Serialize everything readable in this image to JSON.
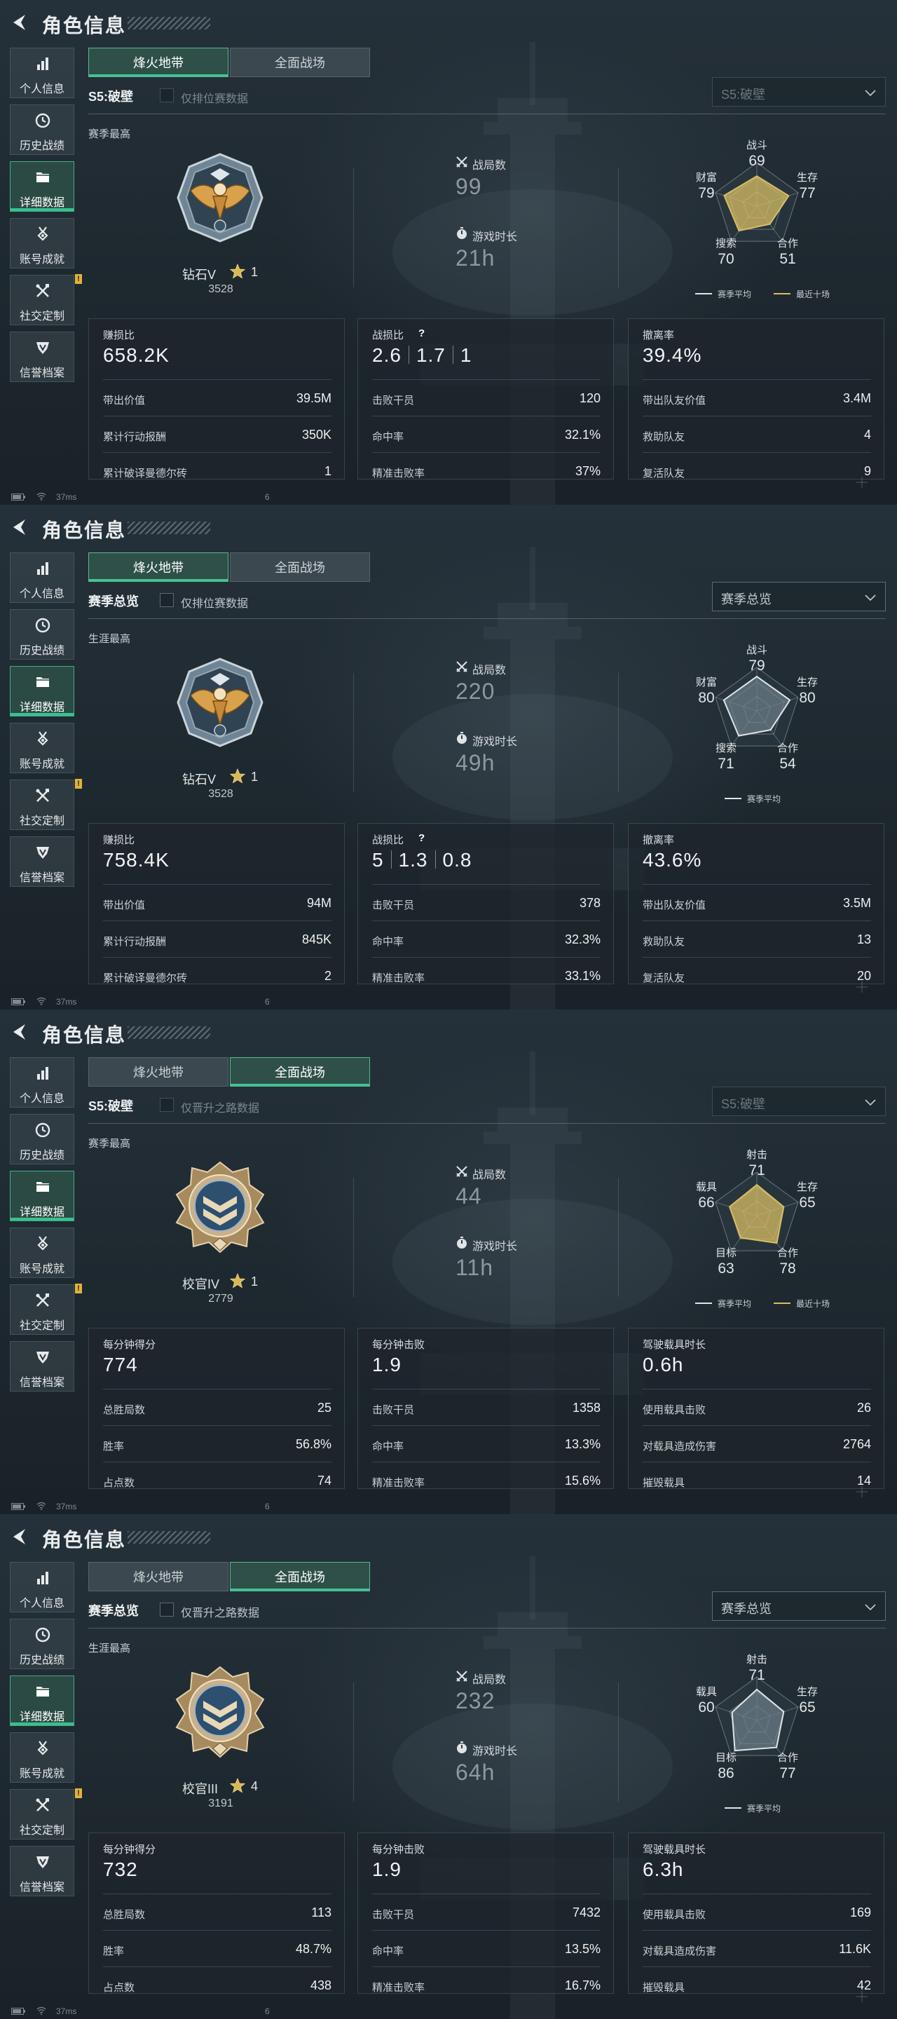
{
  "colors": {
    "accent_green": "#3fc594",
    "season_series": "#d7bd64",
    "avg_series": "#dfe5e8",
    "badge_gold": "#e2b33a"
  },
  "panels": [
    {
      "header": {
        "title": "角色信息"
      },
      "sidebar": [
        {
          "label": "个人信息",
          "icon": "bar-chart-icon"
        },
        {
          "label": "历史战绩",
          "icon": "clock-icon"
        },
        {
          "label": "详细数据",
          "icon": "folder-icon",
          "active": true
        },
        {
          "label": "账号成就",
          "icon": "medal-icon"
        },
        {
          "label": "社交定制",
          "icon": "tools-icon",
          "badge": "!"
        },
        {
          "label": "信誉档案",
          "icon": "shield-icon"
        }
      ],
      "tabs": [
        {
          "label": "烽火地带",
          "active": true
        },
        {
          "label": "全面战场",
          "active": false
        }
      ],
      "season_label": "S5:破壁",
      "checkbox_label": "仅排位赛数据",
      "dropdown": "S5:破壁",
      "best_label": "赛季最高",
      "rank": {
        "name": "钻石V",
        "stars": "1",
        "score": "3528",
        "badge": "diamond-eagle-badge"
      },
      "stats": [
        {
          "label": "战局数",
          "value": "99",
          "icon": "crossed-swords-icon"
        },
        {
          "label": "游戏时长",
          "value": "21h",
          "icon": "timer-icon"
        }
      ],
      "radar": {
        "axes": [
          "战斗",
          "生存",
          "合作",
          "搜索",
          "财富"
        ],
        "values": [
          69,
          77,
          51,
          70,
          79
        ],
        "legend": [
          "赛季平均",
          "最近十场"
        ]
      },
      "cards": [
        {
          "head": "赚损比",
          "big": "658.2K",
          "rows": [
            [
              "带出价值",
              "39.5M"
            ],
            [
              "累计行动报酬",
              "350K"
            ],
            [
              "累计破译曼德尔砖",
              "1"
            ]
          ]
        },
        {
          "head": "战损比",
          "ratio": [
            "2.6",
            "1.7",
            "1"
          ],
          "rows": [
            [
              "击败干员",
              "120"
            ],
            [
              "命中率",
              "32.1%"
            ],
            [
              "精准击败率",
              "37%"
            ]
          ]
        },
        {
          "head": "撤离率",
          "big": "39.4%",
          "rows": [
            [
              "带出队友价值",
              "3.4M"
            ],
            [
              "救助队友",
              "4"
            ],
            [
              "复活队友",
              "9"
            ]
          ]
        }
      ],
      "status": {
        "ping": "37ms",
        "num": "6"
      }
    },
    {
      "header": {
        "title": "角色信息"
      },
      "sidebar": [
        {
          "label": "个人信息",
          "icon": "bar-chart-icon"
        },
        {
          "label": "历史战绩",
          "icon": "clock-icon"
        },
        {
          "label": "详细数据",
          "icon": "folder-icon",
          "active": true
        },
        {
          "label": "账号成就",
          "icon": "medal-icon"
        },
        {
          "label": "社交定制",
          "icon": "tools-icon",
          "badge": "!"
        },
        {
          "label": "信誉档案",
          "icon": "shield-icon"
        }
      ],
      "tabs": [
        {
          "label": "烽火地带",
          "active": true
        },
        {
          "label": "全面战场",
          "active": false
        }
      ],
      "season_label": "赛季总览",
      "checkbox_label": "仅排位赛数据",
      "dropdown": "赛季总览",
      "best_label": "生涯最高",
      "rank": {
        "name": "钻石V",
        "stars": "1",
        "score": "3528",
        "badge": "diamond-eagle-badge"
      },
      "stats": [
        {
          "label": "战局数",
          "value": "220",
          "icon": "crossed-swords-icon"
        },
        {
          "label": "游戏时长",
          "value": "49h",
          "icon": "timer-icon"
        }
      ],
      "radar": {
        "axes": [
          "战斗",
          "生存",
          "合作",
          "搜索",
          "财富"
        ],
        "values": [
          79,
          80,
          54,
          71,
          80
        ],
        "legend": [
          "赛季平均"
        ]
      },
      "cards": [
        {
          "head": "赚损比",
          "big": "758.4K",
          "rows": [
            [
              "带出价值",
              "94M"
            ],
            [
              "累计行动报酬",
              "845K"
            ],
            [
              "累计破译曼德尔砖",
              "2"
            ]
          ]
        },
        {
          "head": "战损比",
          "ratio": [
            "5",
            "1.3",
            "0.8"
          ],
          "rows": [
            [
              "击败干员",
              "378"
            ],
            [
              "命中率",
              "32.3%"
            ],
            [
              "精准击败率",
              "33.1%"
            ]
          ]
        },
        {
          "head": "撤离率",
          "big": "43.6%",
          "rows": [
            [
              "带出队友价值",
              "3.5M"
            ],
            [
              "救助队友",
              "13"
            ],
            [
              "复活队友",
              "20"
            ]
          ]
        }
      ],
      "status": {
        "ping": "37ms",
        "num": "6"
      }
    },
    {
      "header": {
        "title": "角色信息"
      },
      "sidebar": [
        {
          "label": "个人信息",
          "icon": "bar-chart-icon"
        },
        {
          "label": "历史战绩",
          "icon": "clock-icon"
        },
        {
          "label": "详细数据",
          "icon": "folder-icon",
          "active": true
        },
        {
          "label": "账号成就",
          "icon": "medal-icon"
        },
        {
          "label": "社交定制",
          "icon": "tools-icon",
          "badge": "!"
        },
        {
          "label": "信誉档案",
          "icon": "shield-icon"
        }
      ],
      "tabs": [
        {
          "label": "烽火地带",
          "active": false
        },
        {
          "label": "全面战场",
          "active": true
        }
      ],
      "season_label": "S5:破壁",
      "checkbox_label": "仅晋升之路数据",
      "dropdown": "S5:破壁",
      "best_label": "赛季最高",
      "rank": {
        "name": "校官IV",
        "stars": "1",
        "score": "2779",
        "badge": "officer-chevron-badge"
      },
      "stats": [
        {
          "label": "战局数",
          "value": "44",
          "icon": "crossed-swords-icon"
        },
        {
          "label": "游戏时长",
          "value": "11h",
          "icon": "timer-icon"
        }
      ],
      "radar": {
        "axes": [
          "射击",
          "生存",
          "合作",
          "目标",
          "载具"
        ],
        "values": [
          71,
          65,
          78,
          63,
          66
        ],
        "legend": [
          "赛季平均",
          "最近十场"
        ]
      },
      "cards": [
        {
          "head": "每分钟得分",
          "big": "774",
          "rows": [
            [
              "总胜局数",
              "25"
            ],
            [
              "胜率",
              "56.8%"
            ],
            [
              "占点数",
              "74"
            ]
          ]
        },
        {
          "head": "每分钟击败",
          "big": "1.9",
          "rows": [
            [
              "击败干员",
              "1358"
            ],
            [
              "命中率",
              "13.3%"
            ],
            [
              "精准击败率",
              "15.6%"
            ]
          ]
        },
        {
          "head": "驾驶载具时长",
          "big": "0.6h",
          "rows": [
            [
              "使用载具击败",
              "26"
            ],
            [
              "对载具造成伤害",
              "2764"
            ],
            [
              "摧毁载具",
              "14"
            ]
          ]
        }
      ],
      "status": {
        "ping": "37ms",
        "num": "6"
      }
    },
    {
      "header": {
        "title": "角色信息"
      },
      "sidebar": [
        {
          "label": "个人信息",
          "icon": "bar-chart-icon"
        },
        {
          "label": "历史战绩",
          "icon": "clock-icon"
        },
        {
          "label": "详细数据",
          "icon": "folder-icon",
          "active": true
        },
        {
          "label": "账号成就",
          "icon": "medal-icon"
        },
        {
          "label": "社交定制",
          "icon": "tools-icon",
          "badge": "!"
        },
        {
          "label": "信誉档案",
          "icon": "shield-icon"
        }
      ],
      "tabs": [
        {
          "label": "烽火地带",
          "active": false
        },
        {
          "label": "全面战场",
          "active": true
        }
      ],
      "season_label": "赛季总览",
      "checkbox_label": "仅晋升之路数据",
      "dropdown": "赛季总览",
      "best_label": "生涯最高",
      "rank": {
        "name": "校官III",
        "stars": "4",
        "score": "3191",
        "badge": "officer-chevron-badge"
      },
      "stats": [
        {
          "label": "战局数",
          "value": "232",
          "icon": "crossed-swords-icon"
        },
        {
          "label": "游戏时长",
          "value": "64h",
          "icon": "timer-icon"
        }
      ],
      "radar": {
        "axes": [
          "射击",
          "生存",
          "合作",
          "目标",
          "载具"
        ],
        "values": [
          71,
          65,
          77,
          86,
          60
        ],
        "legend": [
          "赛季平均"
        ]
      },
      "cards": [
        {
          "head": "每分钟得分",
          "big": "732",
          "rows": [
            [
              "总胜局数",
              "113"
            ],
            [
              "胜率",
              "48.7%"
            ],
            [
              "占点数",
              "438"
            ]
          ]
        },
        {
          "head": "每分钟击败",
          "big": "1.9",
          "rows": [
            [
              "击败干员",
              "7432"
            ],
            [
              "命中率",
              "13.5%"
            ],
            [
              "精准击败率",
              "16.7%"
            ]
          ]
        },
        {
          "head": "驾驶载具时长",
          "big": "6.3h",
          "rows": [
            [
              "使用载具击败",
              "169"
            ],
            [
              "对载具造成伤害",
              "11.6K"
            ],
            [
              "摧毁载具",
              "42"
            ]
          ]
        }
      ],
      "status": {
        "ping": "37ms",
        "num": "6"
      }
    }
  ]
}
